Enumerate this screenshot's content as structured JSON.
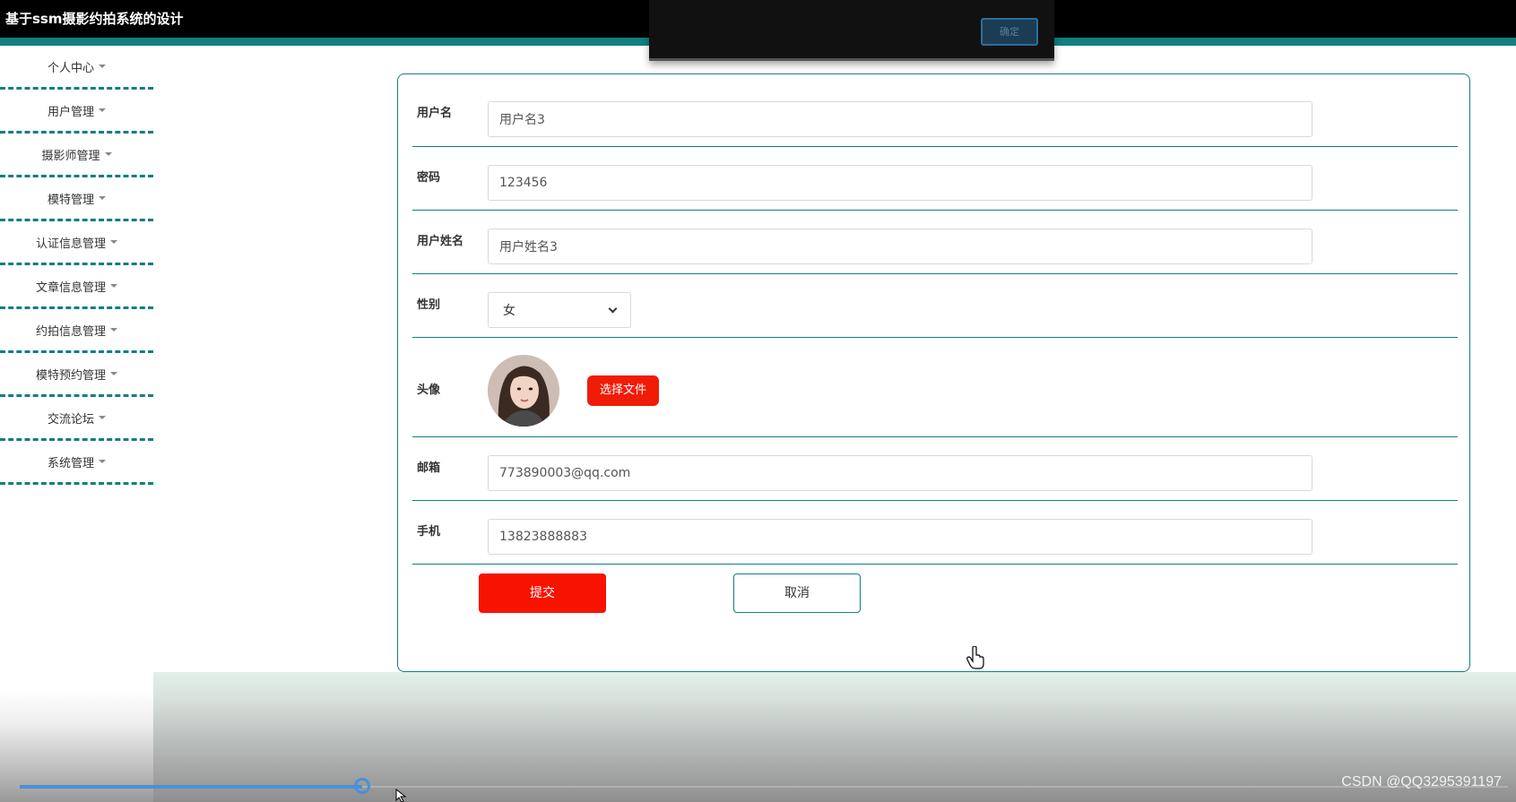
{
  "app": {
    "title": "基于ssm摄影约拍系统的设计"
  },
  "toast": {
    "confirm_label": "确定"
  },
  "sidebar": {
    "items": [
      {
        "label": "个人中心"
      },
      {
        "label": "用户管理"
      },
      {
        "label": "摄影师管理"
      },
      {
        "label": "模特管理"
      },
      {
        "label": "认证信息管理"
      },
      {
        "label": "文章信息管理"
      },
      {
        "label": "约拍信息管理"
      },
      {
        "label": "模特预约管理"
      },
      {
        "label": "交流论坛"
      },
      {
        "label": "系统管理"
      }
    ]
  },
  "form": {
    "username": {
      "label": "用户名",
      "value": "用户名3"
    },
    "password": {
      "label": "密码",
      "value": "123456"
    },
    "realname": {
      "label": "用户姓名",
      "value": "用户姓名3"
    },
    "gender": {
      "label": "性别",
      "value": "女"
    },
    "avatar": {
      "label": "头像",
      "upload_label": "选择文件"
    },
    "email": {
      "label": "邮箱",
      "value": "773890003@qq.com"
    },
    "phone": {
      "label": "手机",
      "value": "13823888883"
    },
    "submit_label": "提交",
    "cancel_label": "取消"
  },
  "player": {
    "progress": 0.23
  },
  "watermark": {
    "text": "CSDN @QQ3295391197"
  },
  "colors": {
    "accent": "#127f80",
    "primary_button": "#f81200",
    "topbar": "#000000"
  },
  "icons": {
    "menu_caret": "caret-down-icon",
    "select_chevron": "chevron-down-icon",
    "cursor": "hand-pointer-icon"
  }
}
